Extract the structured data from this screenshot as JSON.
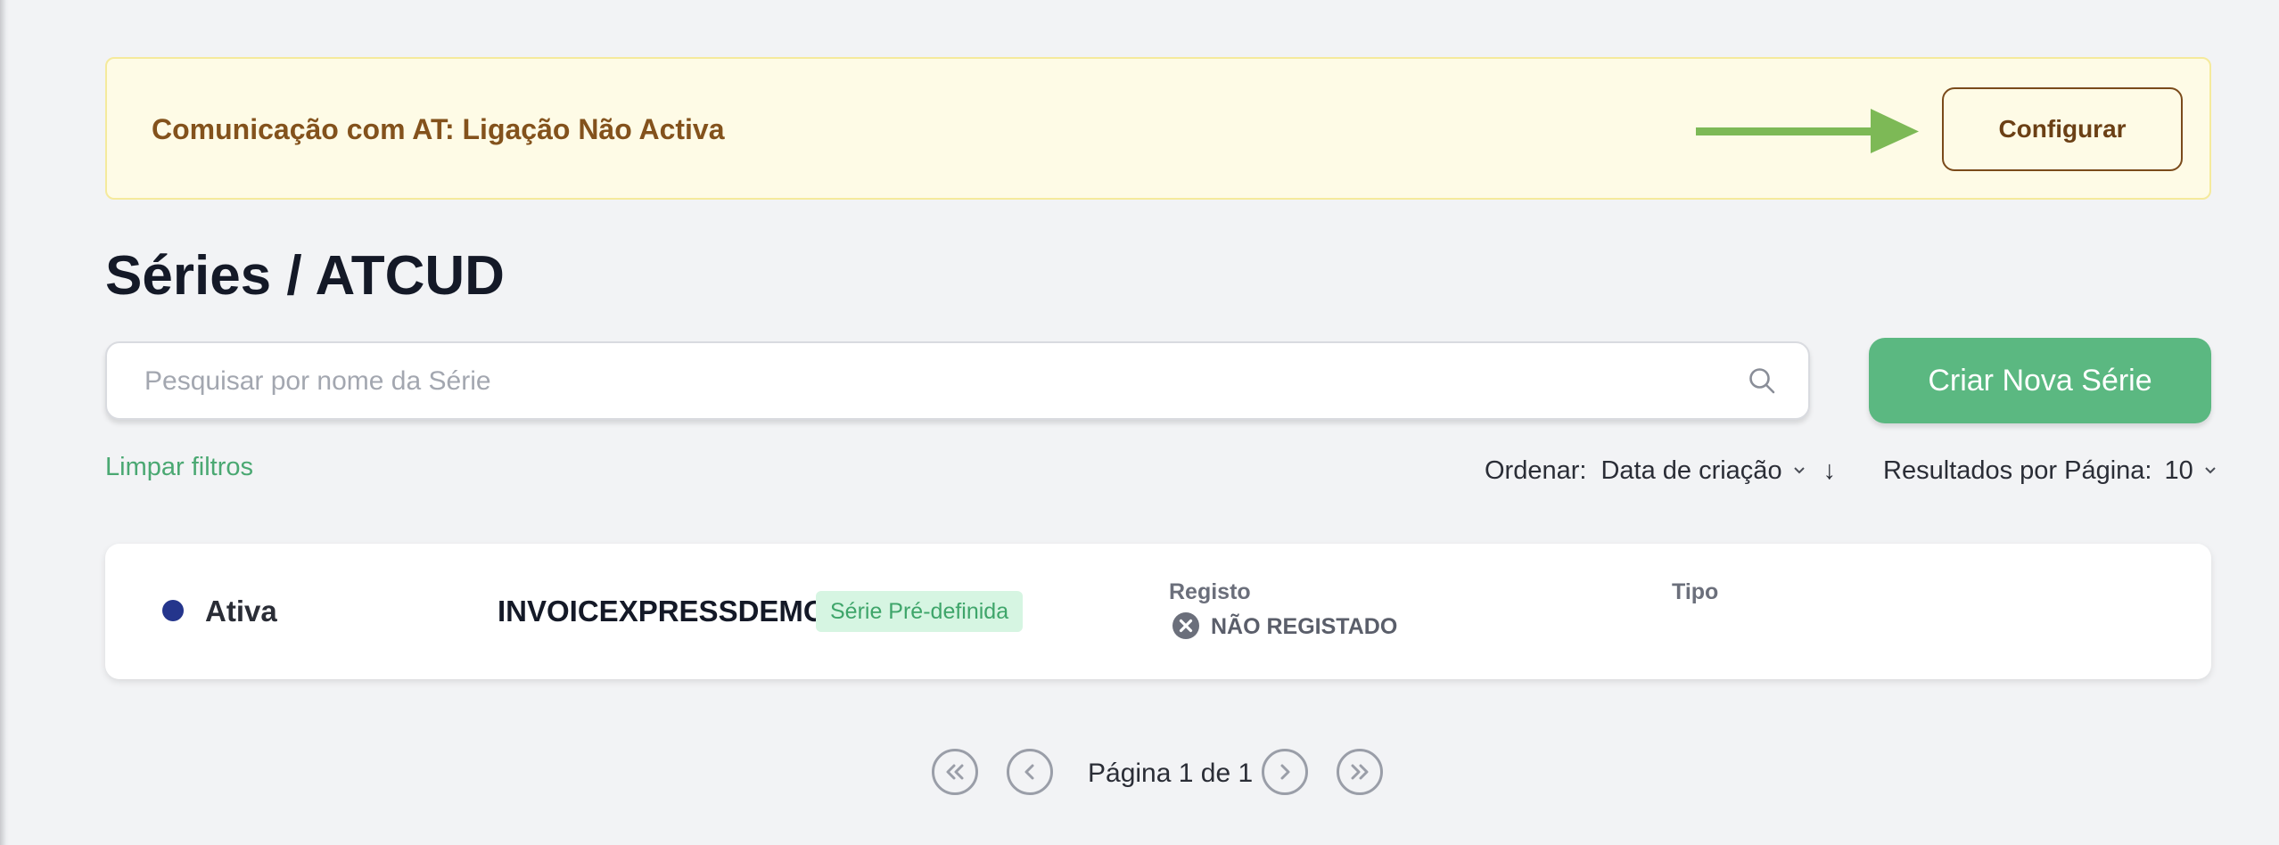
{
  "banner": {
    "message": "Comunicação com AT: Ligação Não Activa",
    "configure_label": "Configurar",
    "arrow_icon": "arrow-right-icon"
  },
  "page": {
    "title": "Séries / ATCUD"
  },
  "search": {
    "placeholder": "Pesquisar por nome da Série",
    "value": "",
    "icon": "search-icon"
  },
  "create_button_label": "Criar Nova Série",
  "filters": {
    "clear_label": "Limpar filtros",
    "sort_label": "Ordenar:",
    "sort_value": "Data de criação",
    "sort_direction": "↓",
    "per_page_label": "Resultados por Página:",
    "per_page_value": "10"
  },
  "series": [
    {
      "status": "Ativa",
      "name": "INVOICEXPRESSDEMO",
      "badge": "Série Pré-definida",
      "registo_label": "Registo",
      "registo_value": "NÃO REGISTADO",
      "tipo_label": "Tipo",
      "tipo_value": ""
    }
  ],
  "pagination": {
    "text": "Página 1 de 1"
  },
  "colors": {
    "accent_green": "#5bb881",
    "banner_bg": "#fefbe6",
    "banner_text": "#83521c",
    "arrow_green": "#7db956",
    "status_active_dot": "#24358c",
    "badge_bg": "#d6f5e2"
  }
}
